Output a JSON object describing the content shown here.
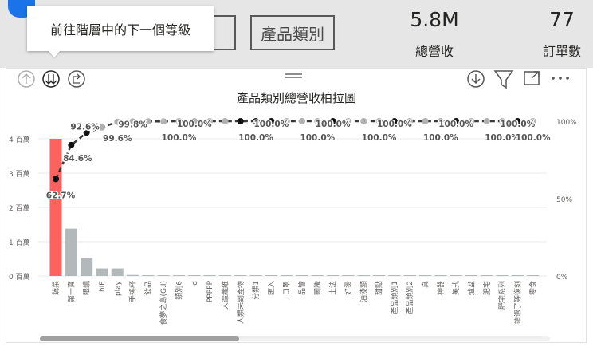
{
  "tooltip": {
    "text": "前往階層中的下一個等級"
  },
  "slicers": [
    {
      "label": ""
    },
    {
      "label": "產品類別"
    }
  ],
  "kpis": [
    {
      "value": "5.8M",
      "label": "總營收"
    },
    {
      "value": "77",
      "label": "訂單數"
    }
  ],
  "toolbar": {
    "icons": [
      "drill-up-icon",
      "drill-down-next-level-icon",
      "expand-all-icon",
      "download-icon",
      "filter-icon",
      "focus-mode-icon",
      "more-options-icon"
    ]
  },
  "chart_data": {
    "type": "bar",
    "title": "產品類別總營收柏拉圖",
    "categories": [
      "蔬菜",
      "第一寶",
      "眼鏡",
      "hIE",
      "play",
      "手搖杯",
      "飲品",
      "食夢之島(G.I)",
      "類別6",
      "d",
      "PPPPP",
      "人造纖維",
      "人類未到產物",
      "分類1",
      "匯入",
      "口罩",
      "品管",
      "圖騰",
      "土法",
      "好燙",
      "油漆類",
      "甜點",
      "產品類別1",
      "產品類別2",
      "真",
      "神器",
      "美式",
      "爐盆",
      "肥宅",
      "肥宅系列",
      "錯過了等復刻",
      "零食"
    ],
    "values": [
      4000000,
      1380000,
      520000,
      220000,
      220000,
      30000,
      20000,
      15000,
      10000,
      5000,
      4000,
      3000,
      3000,
      2000,
      2000,
      2000,
      1500,
      1500,
      1000,
      1000,
      1000,
      800,
      800,
      700,
      600,
      500,
      500,
      400,
      400,
      300,
      200,
      200
    ],
    "ylim": [
      0,
      4000000
    ],
    "yticks": [
      "0 百萬",
      "1 百萬",
      "2 百萬",
      "3 百萬",
      "4 百萬"
    ],
    "y2ticks": [
      "0%",
      "50%",
      "100%"
    ],
    "pct_labels": [
      {
        "i": 0,
        "t": "62.7%"
      },
      {
        "i": 1,
        "t": "84.6%"
      },
      {
        "i": 2,
        "t": "92.6%"
      },
      {
        "i": 4,
        "t": "99.6%"
      },
      {
        "i": 5,
        "t": "99.8%"
      },
      {
        "i": 8,
        "t": "100.0%"
      },
      {
        "i": 9,
        "t": "100.0%"
      },
      {
        "i": 13,
        "t": "100.0%"
      },
      {
        "i": 14,
        "t": "100.0%"
      },
      {
        "i": 17,
        "t": "100.0%"
      },
      {
        "i": 18,
        "t": "100.0%"
      },
      {
        "i": 21,
        "t": "100.0%"
      },
      {
        "i": 22,
        "t": "100.0%"
      },
      {
        "i": 25,
        "t": "100.0%"
      },
      {
        "i": 26,
        "t": "100.0%"
      },
      {
        "i": 29,
        "t": "100.0%"
      },
      {
        "i": 30,
        "t": "100.0%"
      },
      {
        "i": 31,
        "t": "100.0%"
      }
    ],
    "cumulative": [
      0.627,
      0.846,
      0.926,
      0.96,
      0.996,
      0.998,
      0.999,
      0.999,
      1,
      1,
      1,
      1,
      1,
      1,
      1,
      1,
      1,
      1,
      1,
      1,
      1,
      1,
      1,
      1,
      1,
      1,
      1,
      1,
      1,
      1,
      1,
      1
    ],
    "highlight_color": "#fd625e",
    "bar_color": "#b3b8ba",
    "grid": true
  }
}
